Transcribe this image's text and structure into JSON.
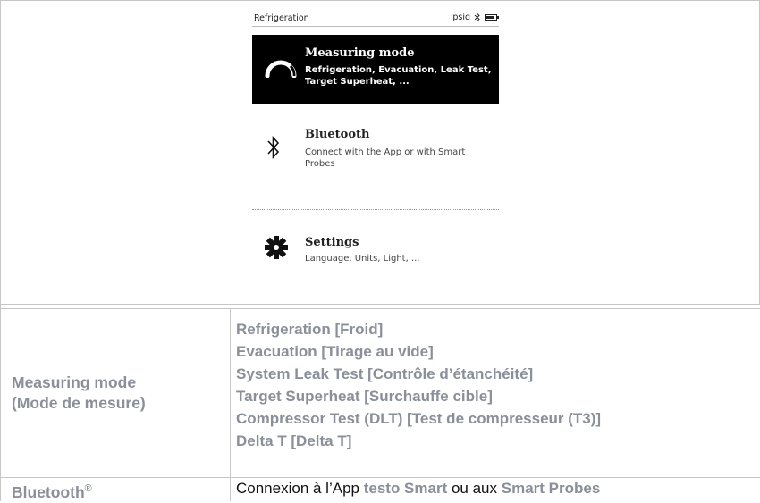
{
  "device": {
    "header_title": "Refrigeration",
    "unit": "psig",
    "icons": [
      "bluetooth-icon",
      "battery-icon"
    ],
    "menu": [
      {
        "name": "Measuring mode",
        "desc": "Refrigeration, Evacuation, Leak Test, Target Superheat, ...",
        "icon": "gauge-icon",
        "selected": true
      },
      {
        "name": "Bluetooth",
        "desc": "Connect with the App or with Smart Probes",
        "icon": "bluetooth-icon",
        "selected": false
      },
      {
        "name": "Settings",
        "desc": "Language, Units, Light, ...",
        "icon": "gear-icon",
        "selected": false
      }
    ]
  },
  "table": {
    "colors": {
      "label": "#8a8f99",
      "border": "#c6c6c6",
      "text": "#111111"
    },
    "rows": [
      {
        "label_line1": "Measuring mode",
        "label_line2": "(Mode de mesure)",
        "items": [
          "Refrigeration [Froid]",
          "Evacuation [Tirage au vide]",
          "System Leak Test [Contrôle d’étanchéité]",
          "Target Superheat [Surchauffe cible]",
          "Compressor Test (DLT) [Test de compresseur (T3)]",
          "Delta T [Delta T]"
        ]
      },
      {
        "label": "Bluetooth",
        "label_sup": "®",
        "desc_parts": [
          "Connexion à l’App ",
          "testo Smart",
          " ou aux ",
          "Smart Probes"
        ]
      }
    ]
  }
}
